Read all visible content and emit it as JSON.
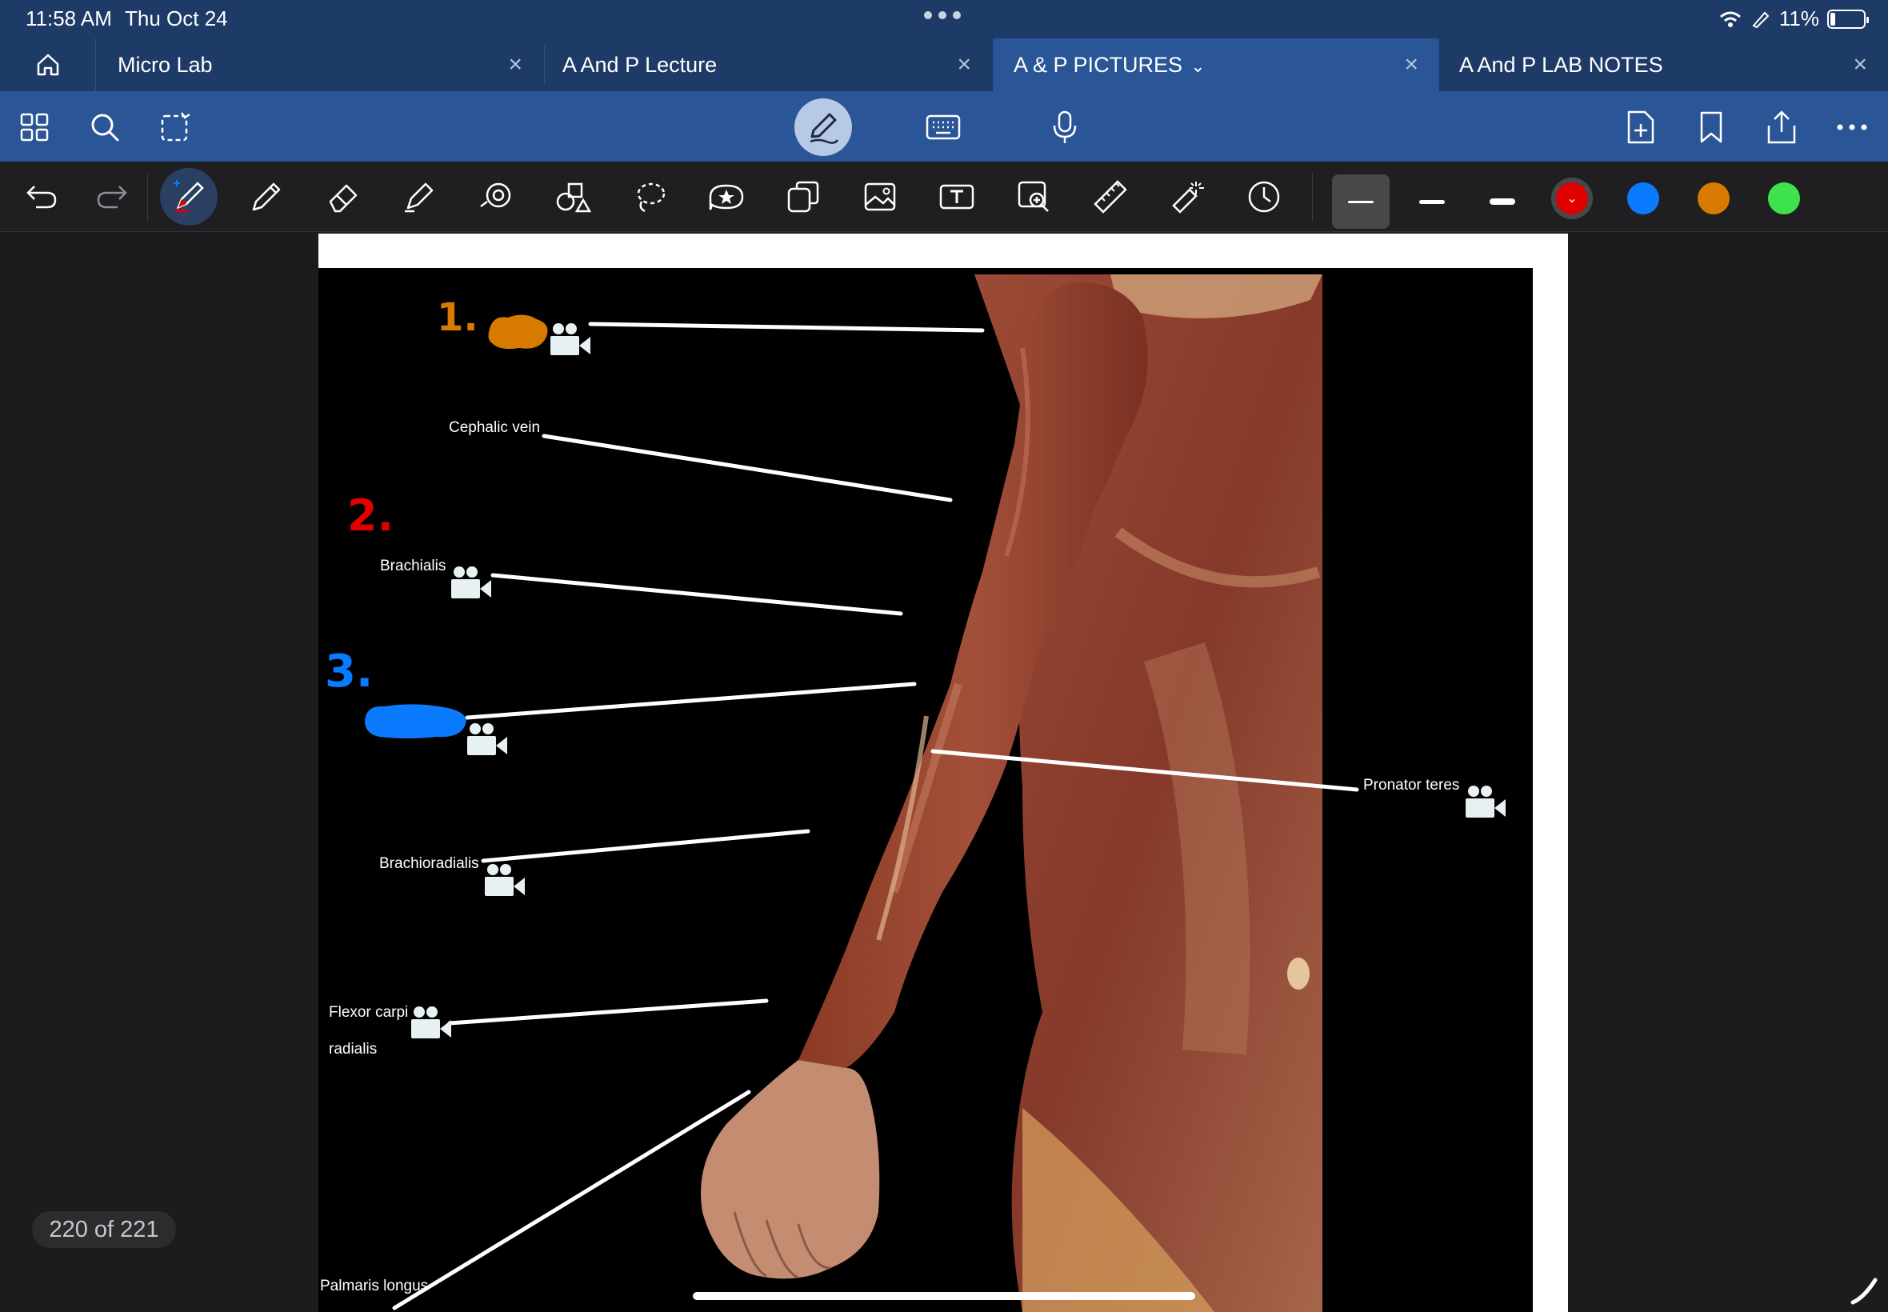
{
  "status": {
    "time": "11:58 AM",
    "date": "Thu Oct 24",
    "battery": "11%"
  },
  "tabs": [
    {
      "label": "Micro Lab",
      "close": "×"
    },
    {
      "label": "A And P Lecture",
      "close": "×"
    },
    {
      "label": "A  & P  PICTURES",
      "close": "×",
      "active": true
    },
    {
      "label": "A And P LAB NOTES",
      "close": "×"
    }
  ],
  "icons": {
    "home": "home-icon",
    "thumbnails": "grid-icon",
    "search": "search-icon",
    "select": "lasso-select-icon",
    "pen_mode": "pencil-icon",
    "keyboard": "keyboard-icon",
    "microphone": "microphone-icon",
    "add_page": "add-page-icon",
    "bookmark": "bookmark-icon",
    "share": "share-icon",
    "more": "more-icon"
  },
  "colors": {
    "red": "#e00000",
    "blue": "#0a7aff",
    "orange": "#d87a00",
    "green": "#3ee24c",
    "accent": "#2a5596"
  },
  "slide": {
    "labels": {
      "cephalic_vein": "Cephalic vein",
      "brachialis": "Brachialis",
      "brachioradialis": "Brachioradialis",
      "flexor_carpi_1": "Flexor carpi",
      "flexor_carpi_2": "radialis",
      "palmaris_longus": "Palmaris longus",
      "pronator_teres": "Pronator teres"
    },
    "annotations": {
      "one": "1.",
      "two": "2.",
      "three": "3."
    }
  },
  "page_counter": "220 of 221"
}
